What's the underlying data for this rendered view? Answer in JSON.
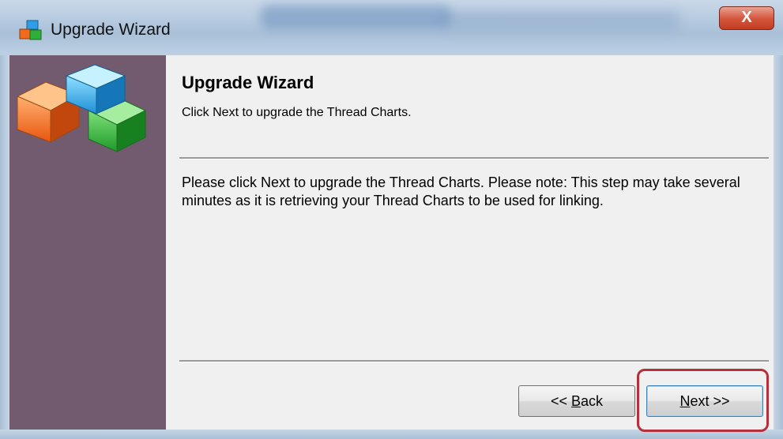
{
  "window": {
    "title": "Upgrade Wizard",
    "close_label": "X"
  },
  "header": {
    "heading": "Upgrade Wizard",
    "subheading": "Click Next to upgrade the Thread Charts."
  },
  "body": {
    "text": "Please click Next to upgrade the Thread Charts.  Please note:  This step may take several minutes as it is retrieving your Thread Charts to be used for linking."
  },
  "buttons": {
    "back_prefix": "<< ",
    "back_key": "B",
    "back_rest": "ack",
    "next_key": "N",
    "next_rest": "ext >>"
  },
  "colors": {
    "sidebar": "#725a6f",
    "content": "#f0f0f0",
    "highlight": "#b5303a"
  },
  "icons": {
    "app": "blocks-icon",
    "sidebar_art": "stacked-cubes-icon"
  }
}
